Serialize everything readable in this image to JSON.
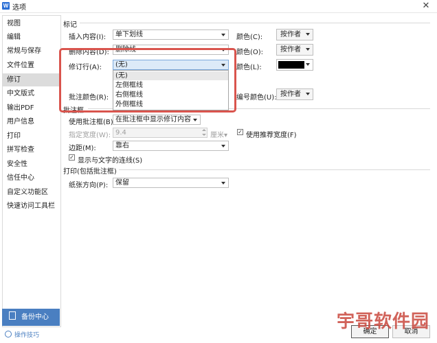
{
  "window": {
    "title": "选项",
    "app_icon_letter": "W"
  },
  "sidebar": {
    "items": [
      "视图",
      "编辑",
      "常规与保存",
      "文件位置",
      "修订",
      "中文版式",
      "输出PDF",
      "用户信息",
      "打印",
      "拼写检查",
      "安全性",
      "信任中心",
      "自定义功能区",
      "快速访问工具栏"
    ],
    "active_index": 4,
    "backup_label": "备份中心",
    "tips_label": "操作技巧"
  },
  "marks": {
    "group_title": "标记",
    "insert_label": "插入内容(I):",
    "insert_value": "单下划线",
    "insert_color_label": "颜色(C):",
    "insert_color_value": "按作者",
    "delete_label": "删除内容(D):",
    "delete_value": "删除线",
    "delete_color_label": "颜色(O):",
    "delete_color_value": "按作者",
    "revline_label": "修订行(A):",
    "revline_value": "(无)",
    "revline_color_label": "颜色(L):",
    "revline_color": "#000000",
    "comment_color_label": "批注颜色(R):",
    "number_color_label": "编号颜色(U):",
    "number_color_value": "按作者"
  },
  "dropdown": {
    "options": [
      "(无)",
      "左侧框线",
      "右侧框线",
      "外侧框线"
    ],
    "selected_index": 0
  },
  "balloon": {
    "group_title": "批注框",
    "use_label": "使用批注框(B):",
    "use_value": "在批注框中显示修订内容",
    "width_label": "指定宽度(W):",
    "width_value": "9.4",
    "width_unit": "厘米",
    "recommend_label": "使用推荐宽度(F)",
    "recommend_checked": true,
    "margin_label": "边距(M):",
    "margin_value": "靠右",
    "show_lines_label": "显示与文字的连线(S)",
    "show_lines_checked": true
  },
  "print": {
    "group_title": "打印(包括批注框)",
    "orientation_label": "纸张方向(P):",
    "orientation_value": "保留"
  },
  "buttons": {
    "ok": "确定",
    "cancel": "取消"
  },
  "watermark": "宇哥软件园",
  "colors": {
    "accent": "#4a7fc1",
    "highlight": "#d9544d",
    "watermark": "#c9483e"
  }
}
